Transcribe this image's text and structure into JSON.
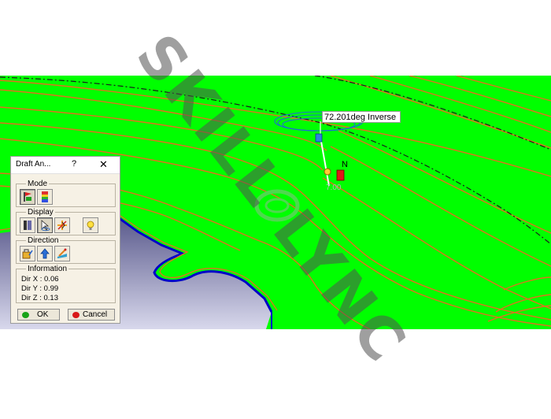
{
  "viewport": {
    "angle_label": "72.201deg Inverse",
    "compass_label": "N",
    "compass_value": "7.00"
  },
  "watermark": "SKILL  LYNC",
  "dialog": {
    "title": "Draft An...",
    "help": "?",
    "close": "✕",
    "mode": {
      "label": "Mode"
    },
    "display": {
      "label": "Display"
    },
    "direction": {
      "label": "Direction"
    },
    "information": {
      "label": "Information",
      "dir_x": "Dir X : 0.06",
      "dir_y": "Dir Y : 0.99",
      "dir_z": "Dir Z : 0.13"
    },
    "ok_label": "OK",
    "cancel_label": "Cancel"
  },
  "icons": {
    "mode": [
      "quick-analysis-mode-icon",
      "full-analysis-mode-icon"
    ],
    "display": [
      "color-scale-icon",
      "cursor-icon",
      "inspections-icon",
      "light-bulb-icon"
    ],
    "direction": [
      "lock-direction-icon",
      "normal-direction-icon",
      "compass-direction-icon"
    ]
  },
  "colors": {
    "surface": "#00ff00",
    "curves": "#e2701f",
    "part_face": "#8e8ea8",
    "part_edge": "#0000c8",
    "ok_dot": "#18a318",
    "cancel_dot": "#d81818"
  }
}
